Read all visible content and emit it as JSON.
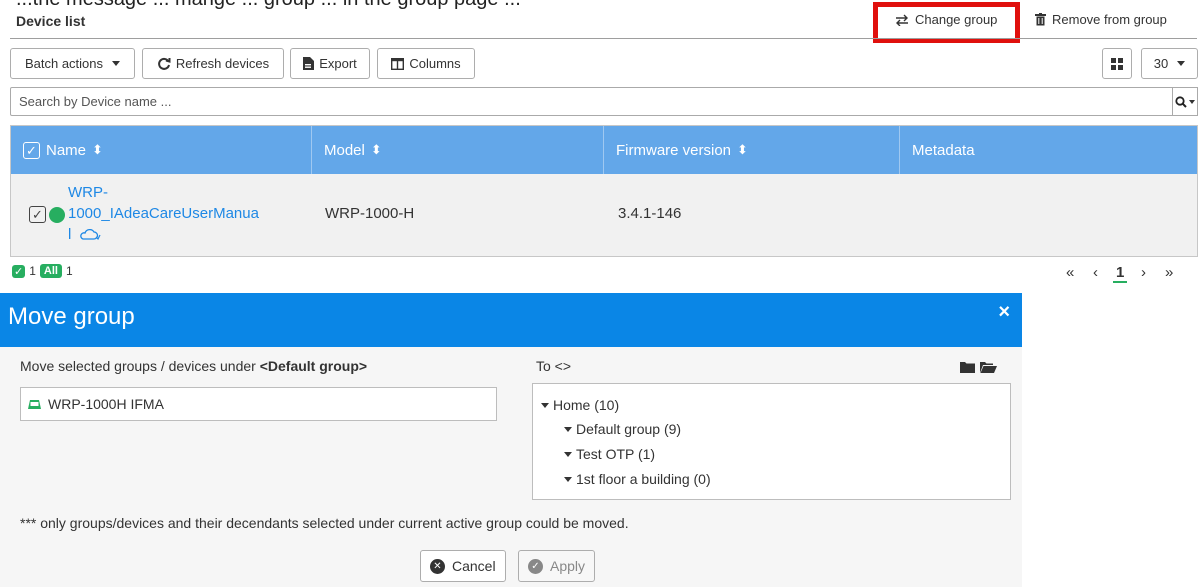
{
  "cutoff_text": "...the message ... mange ... group ... in the group page ...",
  "device_list": {
    "title": "Device list",
    "actions": {
      "change_group": "Change group",
      "remove_from_group": "Remove from group"
    },
    "toolbar": {
      "batch_actions": "Batch actions",
      "refresh_devices": "Refresh devices",
      "export": "Export",
      "columns": "Columns",
      "page_size": "30"
    },
    "search": {
      "placeholder": "Search by Device name ..."
    },
    "table": {
      "headers": {
        "name": "Name",
        "model": "Model",
        "firmware": "Firmware version",
        "metadata": "Metadata"
      },
      "sort_glyph": "⬍",
      "rows": [
        {
          "name_line1": "WRP-",
          "name_line2": "1000_IAdeaCareUserManua",
          "name_line3": "l",
          "model": "WRP-1000-H",
          "firmware": "3.4.1-146",
          "metadata": "",
          "checked": "✓"
        }
      ]
    },
    "footer": {
      "selected_count": "1",
      "all_label": "All",
      "all_count": "1",
      "pager": {
        "first": "«",
        "prev": "‹",
        "current": "1",
        "next": "›",
        "last": "»"
      }
    }
  },
  "modal": {
    "title": "Move group",
    "close": "×",
    "left_label_prefix": "Move selected groups / devices under ",
    "left_label_group": "<Default group>",
    "selected_device": "WRP-1000H IFMA",
    "to_label": "To <>",
    "tree": [
      {
        "label": "Home (10)",
        "level": 0
      },
      {
        "label": "Default group (9)",
        "level": 1
      },
      {
        "label": "Test OTP (1)",
        "level": 1
      },
      {
        "label": "1st floor a building (0)",
        "level": 1
      }
    ],
    "note": "*** only groups/devices and their decendants selected under current active group could be moved.",
    "cancel": "Cancel",
    "apply": "Apply"
  },
  "colors": {
    "table_header": "#63a7e9",
    "modal_header": "#0a86e6",
    "status_online": "#27ae60",
    "highlight": "#e0100d",
    "link": "#1e88e5"
  }
}
